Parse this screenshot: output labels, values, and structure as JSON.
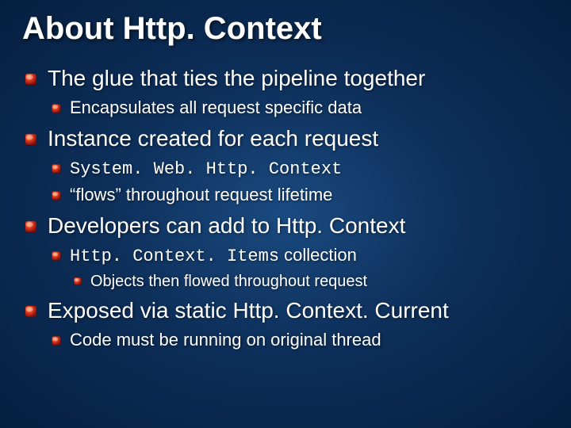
{
  "title": "About Http. Context",
  "items": [
    {
      "text": "The glue that ties the pipeline together",
      "children": [
        {
          "text": "Encapsulates all request specific data"
        }
      ]
    },
    {
      "text": "Instance created for each request",
      "children": [
        {
          "text": "System. Web. Http. Context",
          "mono": true
        },
        {
          "text": "“flows” throughout request lifetime"
        }
      ]
    },
    {
      "text": "Developers can add to Http. Context",
      "children": [
        {
          "mixed": [
            {
              "text": "Http. Context. Items",
              "mono": true
            },
            {
              "text": " collection",
              "mono": false
            }
          ],
          "children": [
            {
              "text": "Objects then flowed throughout request"
            }
          ]
        }
      ]
    },
    {
      "text": "Exposed via  static Http. Context. Current",
      "children": [
        {
          "text": "Code must be running on original thread"
        }
      ]
    }
  ]
}
